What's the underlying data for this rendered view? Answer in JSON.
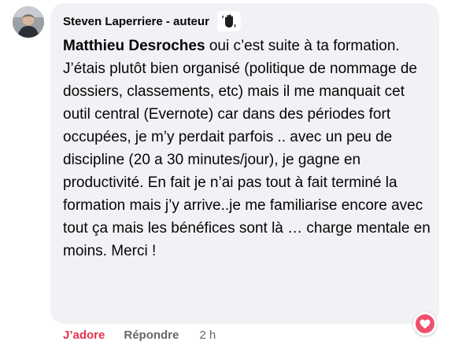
{
  "comment": {
    "author": "Steven Laperriere - auteur",
    "mention": "Matthieu Desroches",
    "text": "oui c’est suite à ta formation. J’étais plutôt bien organisé (politique de nommage de dossiers, classements, etc) mais il me manquait cet outil central (Evernote) car dans des périodes fort occupées, je m’y perdait parfois .. avec un peu de discipline (20 a 30 minutes/jour), je gagne en productivité. En fait je n’ai pas tout à fait terminé la formation mais j’y arrive..je me familiarise encore avec tout ça mais les bénéfices sont là … charge mentale en moins. Merci !"
  },
  "badge_icon": "waving-hand-icon",
  "reaction_icon": "heart-icon",
  "actions": {
    "like": "J’adore",
    "reply": "Répondre",
    "time": "2 h"
  },
  "colors": {
    "bubble": "#f0f2f5",
    "like_active": "#e4334f",
    "heart": "#f0506e",
    "muted": "#65676b"
  }
}
